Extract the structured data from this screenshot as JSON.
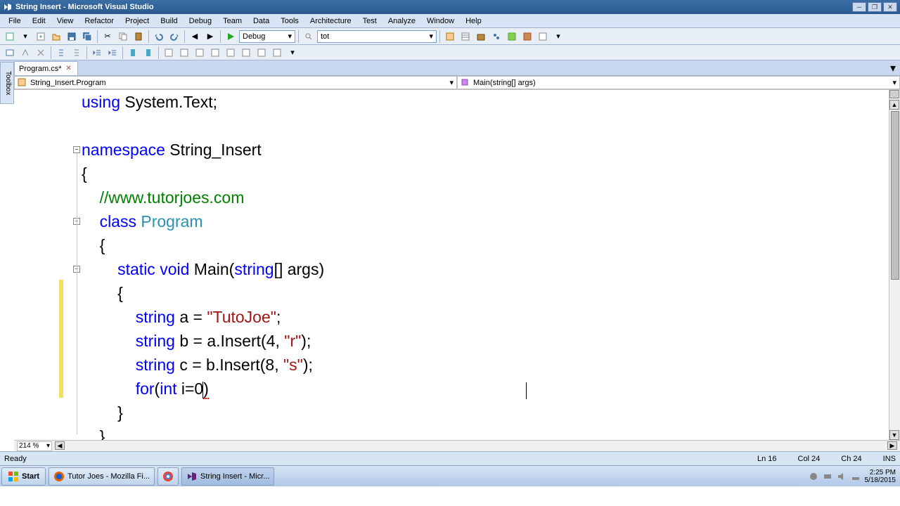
{
  "window": {
    "title": "String Insert - Microsoft Visual Studio"
  },
  "menu": [
    "File",
    "Edit",
    "View",
    "Refactor",
    "Project",
    "Build",
    "Debug",
    "Team",
    "Data",
    "Tools",
    "Architecture",
    "Test",
    "Analyze",
    "Window",
    "Help"
  ],
  "toolbar": {
    "config": "Debug",
    "find": "tot"
  },
  "tab": {
    "filename": "Program.cs*"
  },
  "nav": {
    "class": "String_Insert.Program",
    "member": "Main(string[] args)"
  },
  "sidetab": "Toolbox",
  "code": {
    "l1_using": "using",
    "l1_rest": " System.Text;",
    "l3_ns": "namespace",
    "l3_name": " String_Insert",
    "l4": "{",
    "l5_com": "//www.tutorjoes.com",
    "l6_class": "class ",
    "l6_type": "Program",
    "l7": "{",
    "l8_static": "static ",
    "l8_void": "void",
    "l8_main": " Main(",
    "l8_string": "string",
    "l8_rest": "[] args)",
    "l9": "{",
    "l10_string": "string",
    "l10_rest": " a = ",
    "l10_str": "\"TutoJoe\"",
    "l10_end": ";",
    "l11_string": "string",
    "l11_rest": " b = a.Insert(4, ",
    "l11_str": "\"r\"",
    "l11_end": ");",
    "l12_string": "string",
    "l12_rest": " c = b.Insert(8, ",
    "l12_str": "\"s\"",
    "l12_end": ");",
    "l13_for": "for",
    "l13_paren": "(",
    "l13_int": "int",
    "l13_rest": " i=0",
    "l13_close": ")",
    "l14": "}",
    "l15": "}"
  },
  "zoom": "214 %",
  "status": {
    "ready": "Ready",
    "ln": "Ln 16",
    "col": "Col 24",
    "ch": "Ch 24",
    "ins": "INS"
  },
  "taskbar": {
    "start": "Start",
    "firefox": "Tutor Joes - Mozilla Fi...",
    "vs": "String Insert - Micr...",
    "time": "2:25 PM",
    "date": "5/18/2015"
  }
}
